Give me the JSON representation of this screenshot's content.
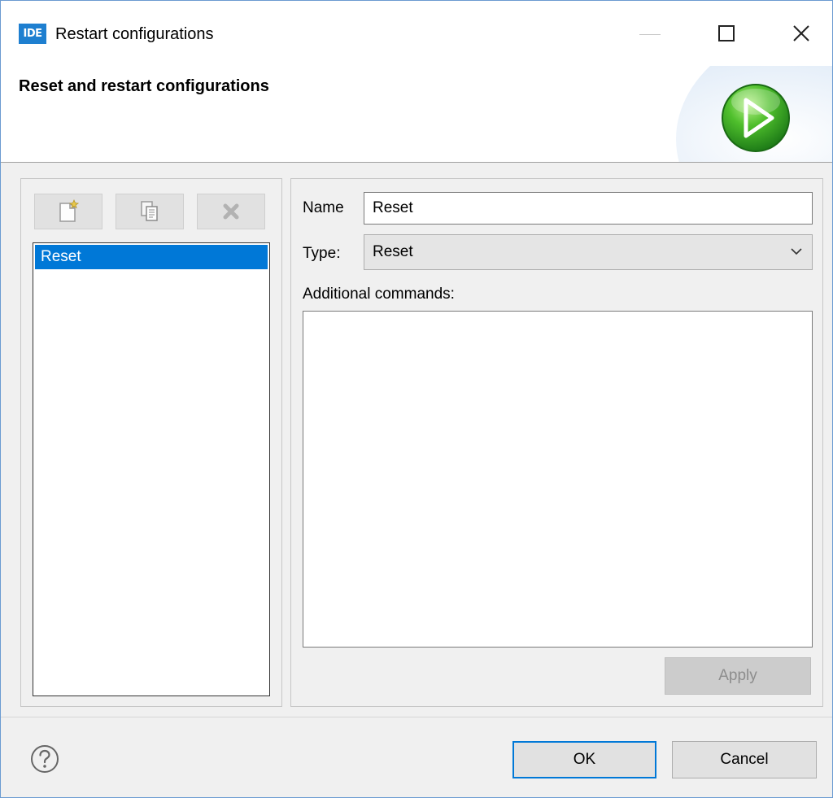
{
  "window": {
    "app_icon_text": "IDE",
    "title": "Restart configurations"
  },
  "banner": {
    "title": "Reset and restart configurations",
    "icon": "green-play-icon"
  },
  "toolbar": {
    "new_icon": "new-config-icon",
    "copy_icon": "copy-config-icon",
    "delete_icon": "delete-config-icon"
  },
  "config_list": {
    "items": [
      {
        "label": "Reset",
        "selected": true
      }
    ]
  },
  "form": {
    "name_label": "Name",
    "name_value": "Reset",
    "type_label": "Type:",
    "type_value": "Reset",
    "additional_label": "Additional commands:",
    "additional_value": ""
  },
  "buttons": {
    "apply": "Apply",
    "ok": "OK",
    "cancel": "Cancel"
  },
  "colors": {
    "accent": "#0078d7",
    "selection": "#0078d7",
    "play_green": "#2e9e2e"
  }
}
